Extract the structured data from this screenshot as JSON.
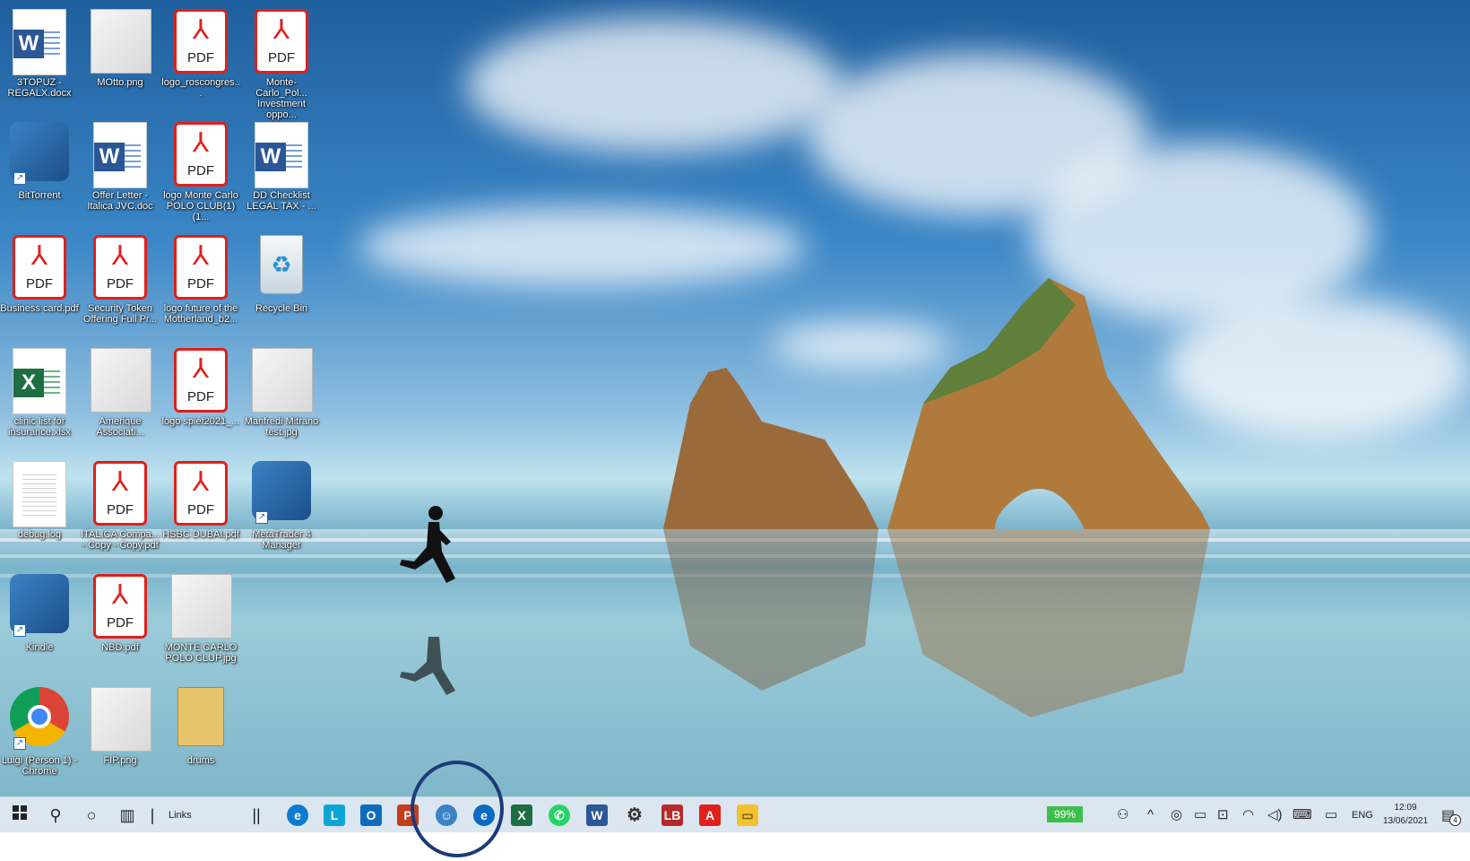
{
  "desktop": {
    "icons": [
      {
        "label": "3TOPUZ -REGALX.docx",
        "type": "word"
      },
      {
        "label": "MOtto.png",
        "type": "image"
      },
      {
        "label": "logo_roscongres...",
        "type": "pdf"
      },
      {
        "label": "Monte-Carlo_Pol... Investment oppo...",
        "type": "pdf"
      },
      {
        "label": "BitTorrent",
        "type": "app"
      },
      {
        "label": "Offer Letter - Italica JVC.doc",
        "type": "word"
      },
      {
        "label": "logo Monte Carlo POLO CLUB(1)(1...",
        "type": "pdf"
      },
      {
        "label": "DD Checklist LEGAL TAX - ...",
        "type": "word"
      },
      {
        "label": "Business card.pdf",
        "type": "pdf"
      },
      {
        "label": "Security Token Offering Full Pr...",
        "type": "pdf"
      },
      {
        "label": "logo future of the Motherland_b2...",
        "type": "pdf"
      },
      {
        "label": "Recycle Bin",
        "type": "bin"
      },
      {
        "label": "clinic list for insurance.xlsx",
        "type": "excel"
      },
      {
        "label": "Amerique Associati...",
        "type": "image"
      },
      {
        "label": "logo spief2021_...",
        "type": "pdf"
      },
      {
        "label": "Manfredi Mitrano test.jpg",
        "type": "image"
      },
      {
        "label": "debug.log",
        "type": "text"
      },
      {
        "label": "ITALICA Compa... - Copy - Copy.pdf",
        "type": "pdf"
      },
      {
        "label": "HSBC DUBAI.pdf",
        "type": "pdf"
      },
      {
        "label": "MetaTrader 4 Manager",
        "type": "app"
      },
      {
        "label": "Kindle",
        "type": "app"
      },
      {
        "label": "NBD.pdf",
        "type": "pdf"
      },
      {
        "label": "MONTE CARLO POLO CLUP.jpg",
        "type": "image"
      },
      {
        "label": "Luigi (Person 1) - Chrome",
        "type": "chrome"
      },
      {
        "label": "FIP.png",
        "type": "image"
      },
      {
        "label": "drums",
        "type": "folder"
      }
    ],
    "pdf_text": "PDF"
  },
  "taskbar": {
    "links_label": "Links",
    "battery": "99%",
    "language": "ENG",
    "time": "12:09",
    "date": "13/06/2021",
    "notification_count": "4",
    "colors": {
      "excel": "#1d6f42",
      "word": "#2b5797",
      "pdf": "#e0201b",
      "outlook": "#0f6cbd",
      "highlight": "#1c3a78"
    }
  }
}
